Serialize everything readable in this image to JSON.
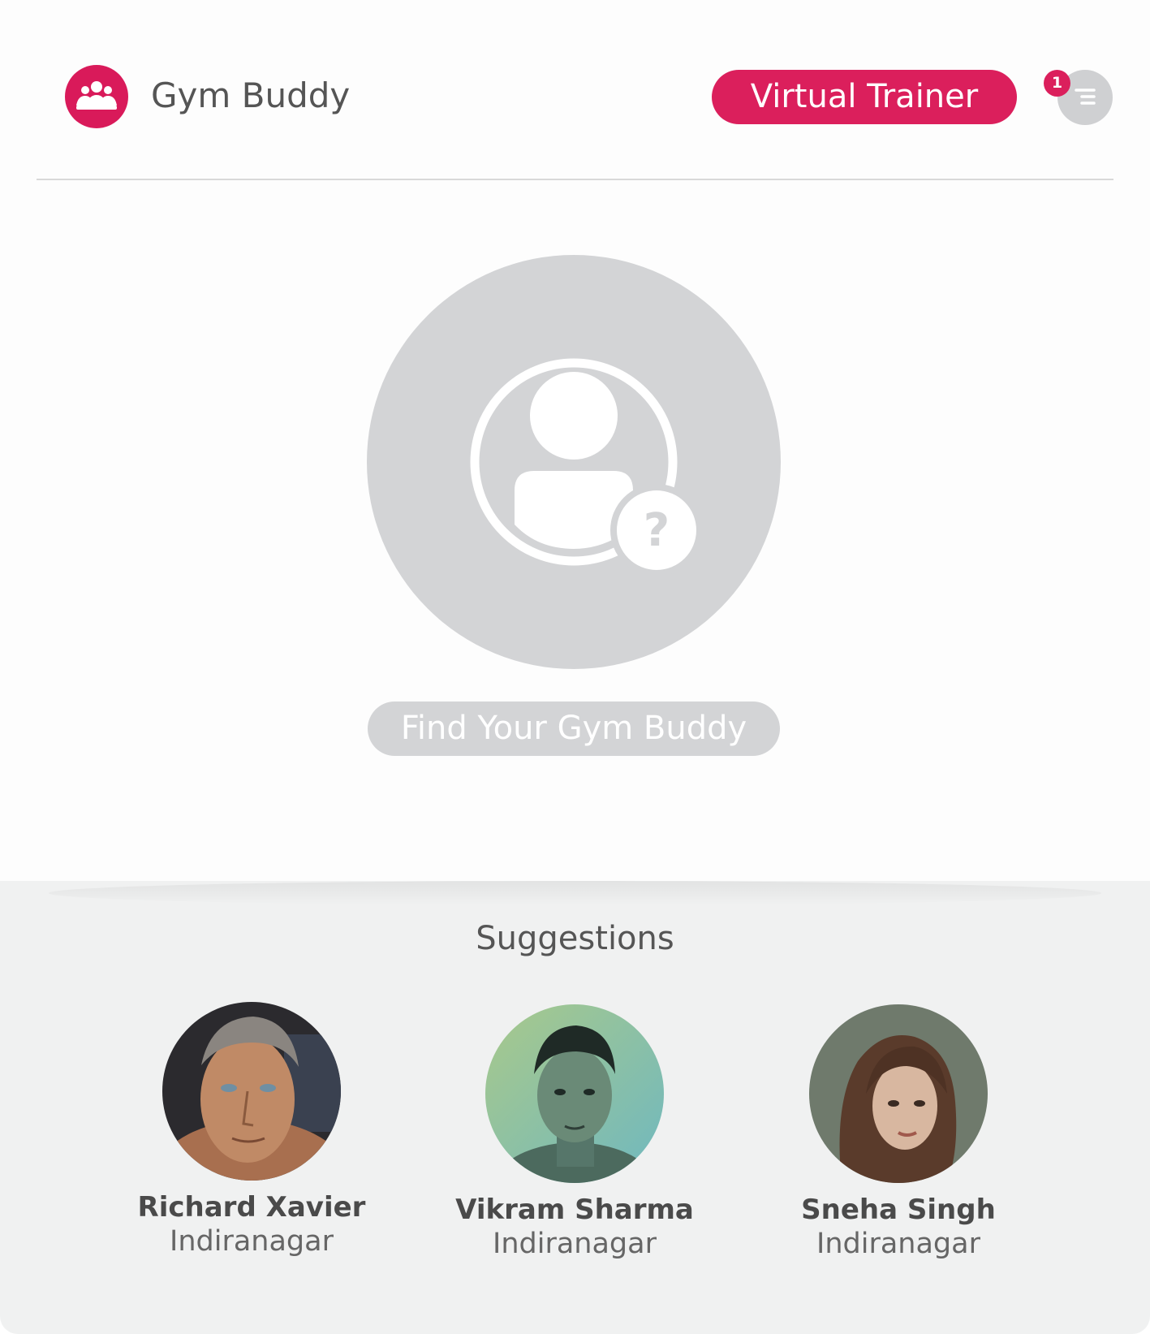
{
  "header": {
    "app_title": "Gym Buddy",
    "trainer_button_label": "Virtual Trainer",
    "notification_count": "1",
    "logo_icon": "group-icon",
    "menu_icon": "hamburger-menu-icon"
  },
  "hero": {
    "avatar_icon": "unknown-user-icon",
    "find_button_label": "Find Your Gym Buddy"
  },
  "suggestions": {
    "title": "Suggestions",
    "people": [
      {
        "name": "Richard Xavier",
        "location": "Indiranagar"
      },
      {
        "name": "Vikram Sharma",
        "location": "Indiranagar"
      },
      {
        "name": "Sneha Singh",
        "location": "Indiranagar"
      }
    ]
  },
  "colors": {
    "accent": "#db1f5c",
    "placeholder_gray": "#d3d4d6",
    "text_dark": "#555555",
    "bottom_background": "#f0f1f1"
  }
}
